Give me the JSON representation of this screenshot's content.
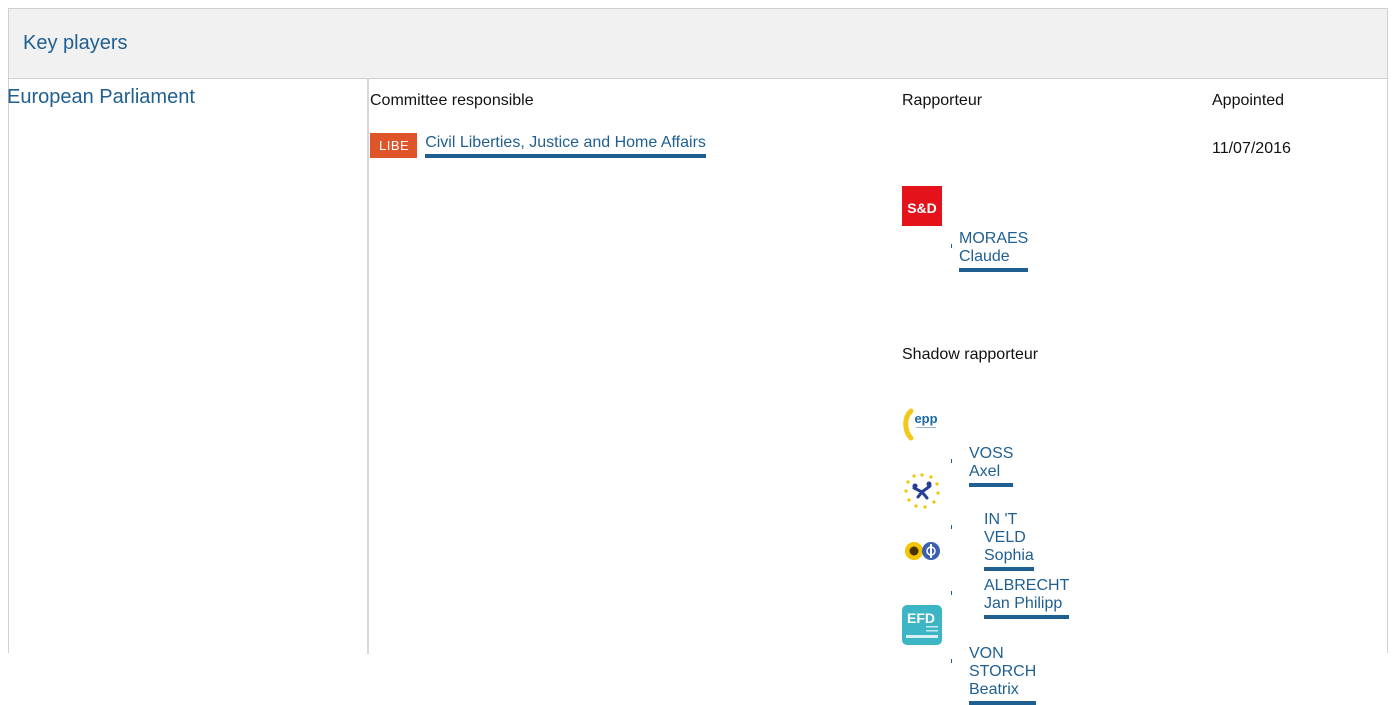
{
  "panel": {
    "title": "Key players"
  },
  "institution": "European Parliament",
  "headers": {
    "committee": "Committee responsible",
    "rapporteur": "Rapporteur",
    "appointed": "Appointed"
  },
  "committee": {
    "code": "LIBE",
    "name": "Civil Liberties, Justice and Home Affairs",
    "appointed": "11/07/2016",
    "badge_color": "#e0542a"
  },
  "rapporteur": {
    "name": "MORAES Claude",
    "group_logo": "S&D"
  },
  "shadow_label": "Shadow rapporteur",
  "shadow_rapporteurs": [
    {
      "name": "VOSS Axel",
      "group_logo": "epp"
    },
    {
      "name": "IN 'T VELD Sophia",
      "group_logo": "alde-logo"
    },
    {
      "name": "ALBRECHT Jan Philipp",
      "group_logo": "greens-efa-logo"
    },
    {
      "name": "VON STORCH Beatrix",
      "group_logo": "EFD"
    }
  ],
  "colors": {
    "link": "#1f5f92",
    "header_bg": "#f1f1f1"
  }
}
